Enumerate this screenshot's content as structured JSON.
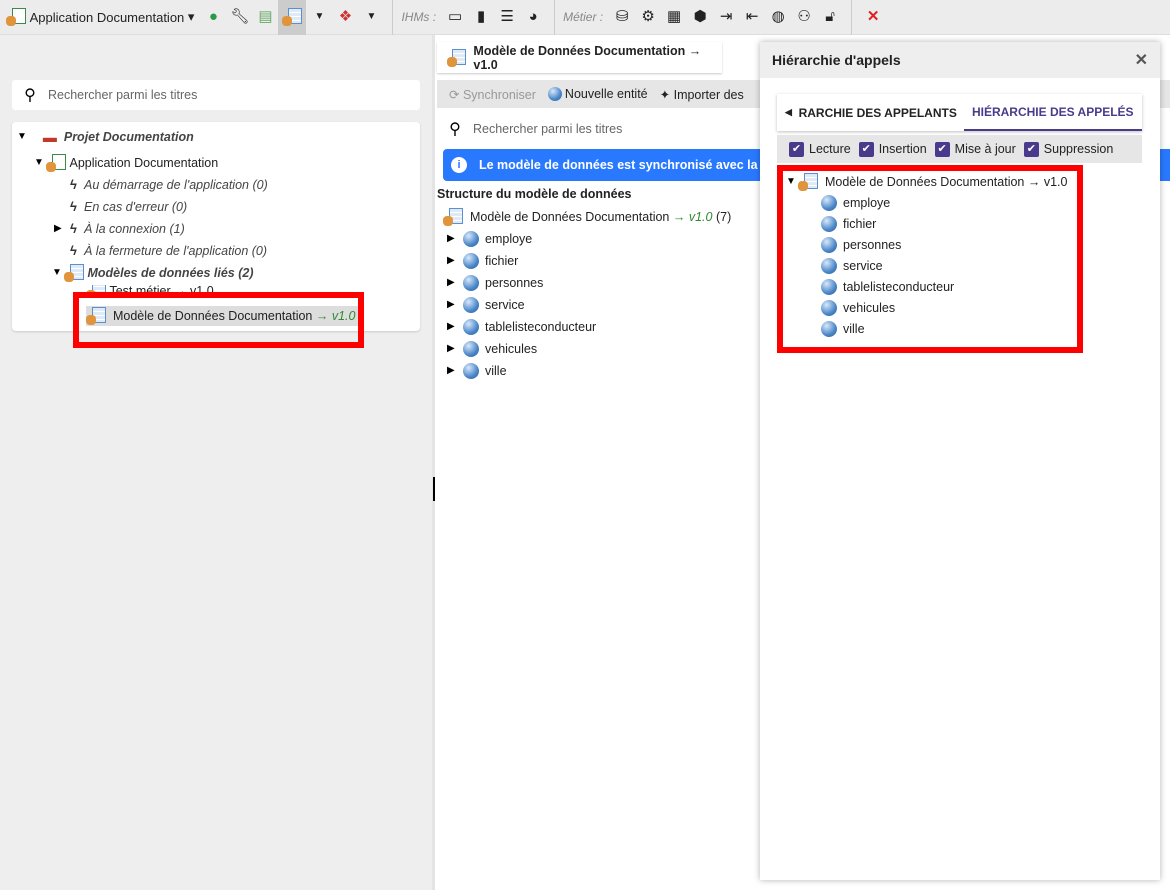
{
  "toolbar": {
    "app_name": "Application Documentation",
    "ihms_label": "IHMs :",
    "metier_label": "Métier :",
    "icons": [
      "play-icon",
      "wrench-icon",
      "list-icon",
      "datamodel-icon",
      "components-icon",
      "monitor-icon",
      "comment-icon",
      "menu-icon",
      "palette-icon",
      "database-flow-icon",
      "gears-icon",
      "table-icon",
      "cube-icon",
      "export-icon",
      "import-icon",
      "globe-icon",
      "users-icon",
      "unlock-icon",
      "close-icon"
    ]
  },
  "left": {
    "search_placeholder": "Rechercher parmi les titres",
    "tree": {
      "project": "Projet Documentation",
      "app": "Application Documentation",
      "events": [
        "Au démarrage de l'application (0)",
        "En cas d'erreur (0)",
        "À la connexion (1)",
        "À la fermeture de l'application (0)"
      ],
      "models_folder": "Modèles de données liés (2)",
      "hidden_model": "Test métier → v1.0",
      "model": "Modèle de Données Documentation",
      "model_version": "→ v1.0"
    }
  },
  "center": {
    "tab_title": "Modèle de Données Documentation → v1.0",
    "actions": {
      "sync": "Synchroniser",
      "new_entity": "Nouvelle entité",
      "import": "Importer des"
    },
    "search_placeholder": "Rechercher parmi les titres",
    "info": "Le modèle de données est synchronisé avec la base",
    "structure_title": "Structure du modèle de données",
    "root": "Modèle de Données Documentation",
    "root_version": "→ v1.0",
    "root_count": "(7)",
    "entities": [
      "employe",
      "fichier",
      "personnes",
      "service",
      "tablelisteconducteur",
      "vehicules",
      "ville"
    ]
  },
  "panel": {
    "title": "Hiérarchie d'appels",
    "tabs": [
      "RARCHIE DES APPELANTS",
      "HIÉRARCHIE DES APPELÉS"
    ],
    "filters": [
      "Lecture",
      "Insertion",
      "Mise à jour",
      "Suppression"
    ],
    "root": "Modèle de Données Documentation → v1.0",
    "entities": [
      "employe",
      "fichier",
      "personnes",
      "service",
      "tablelisteconducteur",
      "vehicules",
      "ville"
    ]
  },
  "colors": {
    "accent": "#4a3a8c",
    "info": "#2979ff",
    "highlight": "#ff0000",
    "version": "#2e8b2e"
  }
}
